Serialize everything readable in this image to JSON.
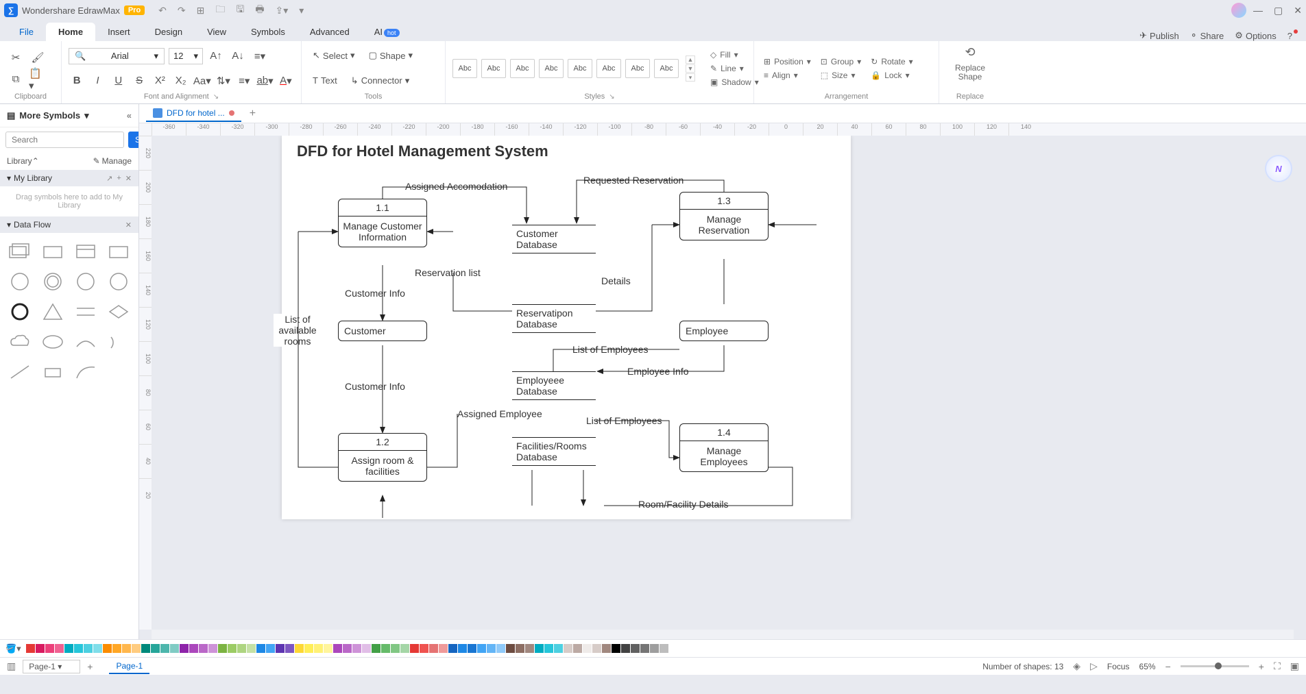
{
  "app": {
    "name": "Wondershare EdrawMax",
    "badge": "Pro"
  },
  "menu": {
    "tabs": [
      "File",
      "Home",
      "Insert",
      "Design",
      "View",
      "Symbols",
      "Advanced",
      "AI"
    ],
    "active": "Home",
    "right": {
      "publish": "Publish",
      "share": "Share",
      "options": "Options"
    }
  },
  "ribbon": {
    "font": {
      "family": "Arial",
      "size": "12"
    },
    "groups": {
      "clipboard": "Clipboard",
      "fontAlign": "Font and Alignment",
      "tools": "Tools",
      "styles": "Styles",
      "arrangement": "Arrangement",
      "replace": "Replace"
    },
    "tools": {
      "select": "Select",
      "shape": "Shape",
      "text": "Text",
      "connector": "Connector"
    },
    "styleLabel": "Abc",
    "style": {
      "fill": "Fill",
      "line": "Line",
      "shadow": "Shadow"
    },
    "arrange": {
      "position": "Position",
      "group": "Group",
      "rotate": "Rotate",
      "align": "Align",
      "size": "Size",
      "lock": "Lock"
    },
    "replace": {
      "replaceShape": "Replace Shape",
      "replace2": "Replace"
    }
  },
  "doc": {
    "tab": "DFD for hotel ...",
    "add": "+"
  },
  "sidebar": {
    "more": "More Symbols",
    "searchPlaceholder": "Search",
    "searchBtn": "Search",
    "library": "Library",
    "manage": "Manage",
    "myLibrary": "My Library",
    "myLibHint": "Drag symbols here to add to My Library",
    "dataFlow": "Data Flow"
  },
  "hruler": [
    "-360",
    "-340",
    "-320",
    "-300",
    "-280",
    "-260",
    "-240",
    "-220",
    "-200",
    "-180",
    "-160",
    "-140",
    "-120",
    "-100",
    "-80",
    "-60",
    "-40",
    "-20",
    "0",
    "20",
    "40",
    "60",
    "80",
    "100",
    "120",
    "140"
  ],
  "vruler": [
    "220",
    "200",
    "180",
    "160",
    "140",
    "120",
    "100",
    "80",
    "60",
    "40",
    "20"
  ],
  "diagram": {
    "title": "DFD for Hotel Management System",
    "p11": {
      "num": "1.1",
      "txt": "Manage Customer Information"
    },
    "p12": {
      "num": "1.2",
      "txt": "Assign room & facilities"
    },
    "p13": {
      "num": "1.3",
      "txt": "Manage Reservation"
    },
    "p14": {
      "num": "1.4",
      "txt": "Manage Employees"
    },
    "customer": "Customer",
    "employee": "Employee",
    "stores": {
      "custdb": "Customer Database",
      "resdb": "Reservatipon Database",
      "empdb": "Employeee Database",
      "facdb": "Facilities/Rooms Database"
    },
    "labels": {
      "assignedAcc": "Assigned Accomodation",
      "reqRes": "Requested Reservation",
      "resList": "Reservation list",
      "custInfo1": "Customer Info",
      "custInfo2": "Customer Info",
      "listRooms": "List of available rooms",
      "details": "Details",
      "listEmp1": "List of Employees",
      "empInfo": "Employee Info",
      "listEmp2": "List of Employees",
      "assignedEmp": "Assigned Employee",
      "roomFac": "Room/Facility Details"
    }
  },
  "colors": [
    "#e53935",
    "#d81b60",
    "#ec407a",
    "#f06292",
    "#00acc1",
    "#26c6da",
    "#4dd0e1",
    "#80deea",
    "#fb8c00",
    "#ffa726",
    "#ffb74d",
    "#ffcc80",
    "#00897b",
    "#26a69a",
    "#4db6ac",
    "#80cbc4",
    "#8e24aa",
    "#ab47bc",
    "#ba68c8",
    "#ce93d8",
    "#7cb342",
    "#9ccc65",
    "#aed581",
    "#c5e1a5",
    "#1e88e5",
    "#42a5f5",
    "#5e35b1",
    "#7e57c2",
    "#fdd835",
    "#ffee58",
    "#fff176",
    "#fff59d",
    "#ab47bc",
    "#ba68c8",
    "#ce93d8",
    "#e1bee7",
    "#43a047",
    "#66bb6a",
    "#81c784",
    "#a5d6a7",
    "#e53935",
    "#ef5350",
    "#e57373",
    "#ef9a9a",
    "#1565c0",
    "#1e88e5",
    "#1976d2",
    "#42a5f5",
    "#64b5f6",
    "#90caf9",
    "#6d4c41",
    "#8d6e63",
    "#a1887f",
    "#00acc1",
    "#26c6da",
    "#4dd0e1",
    "#d7ccc8",
    "#bcaaa4",
    "#efebe9",
    "#d7ccc8",
    "#a1887f",
    "#000000",
    "#424242",
    "#616161",
    "#757575",
    "#9e9e9e",
    "#bdbdbd",
    "#ffffff"
  ],
  "status": {
    "page": "Page-1",
    "activePage": "Page-1",
    "shapes": "Number of shapes: 13",
    "focus": "Focus",
    "zoom": "65%"
  }
}
